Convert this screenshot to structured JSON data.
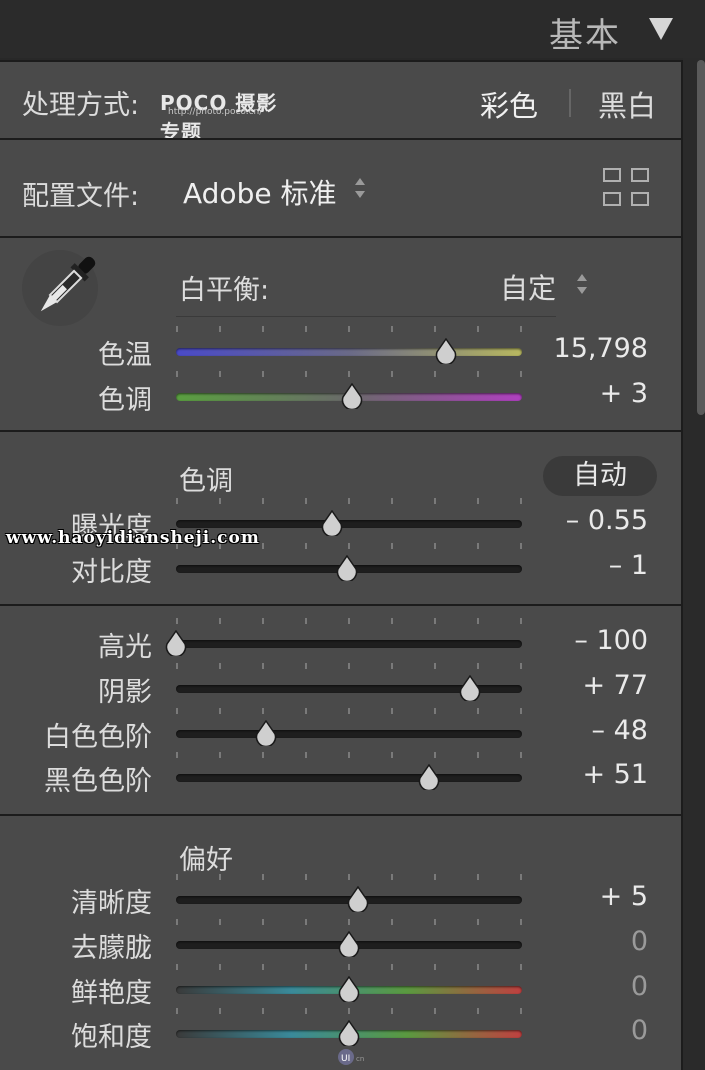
{
  "header": {
    "title": "基本"
  },
  "treatment": {
    "label": "处理方式:",
    "logo_text": "POCO 摄影专题",
    "logo_url": "http://photo.poco.cn/",
    "option_color": "彩色",
    "option_bw": "黑白"
  },
  "profile": {
    "label": "配置文件:",
    "value": "Adobe 标准"
  },
  "white_balance": {
    "label": "白平衡:",
    "value": "自定",
    "sliders": [
      {
        "label": "色温",
        "value": "15,798",
        "level": 0.78
      },
      {
        "label": "色调",
        "value": "+ 3",
        "level": 0.51
      }
    ]
  },
  "tone": {
    "label": "色调",
    "auto_label": "自动",
    "sliders": [
      {
        "label": "曝光度",
        "value": "– 0.55",
        "level": 0.45
      },
      {
        "label": "对比度",
        "value": "– 1",
        "level": 0.495
      }
    ]
  },
  "tone_detail": {
    "sliders": [
      {
        "label": "高光",
        "value": "– 100",
        "level": 0.0
      },
      {
        "label": "阴影",
        "value": "+ 77",
        "level": 0.85
      },
      {
        "label": "白色色阶",
        "value": "– 48",
        "level": 0.26
      },
      {
        "label": "黑色色阶",
        "value": "+ 51",
        "level": 0.73
      }
    ]
  },
  "presence": {
    "label": "偏好",
    "sliders": [
      {
        "label": "清晰度",
        "value": "+ 5",
        "level": 0.525
      },
      {
        "label": "去朦胧",
        "value": "0",
        "level": 0.5
      },
      {
        "label": "鲜艳度",
        "value": "0",
        "level": 0.5
      },
      {
        "label": "饱和度",
        "value": "0",
        "level": 0.5
      }
    ]
  },
  "watermark": "www.haoyidiansheji.com",
  "colors": {
    "panel_bg": "#4a4a4a",
    "temp_gradient": [
      "#4a4ac8",
      "#6a6a88",
      "#b8b860"
    ],
    "tint_gradient": [
      "#5aa040",
      "#6a6a6a",
      "#b040c0"
    ],
    "vibrance_gradient": [
      "#3a3a3a",
      "#3a8a9a",
      "#5a9a40",
      "#c04040"
    ]
  }
}
